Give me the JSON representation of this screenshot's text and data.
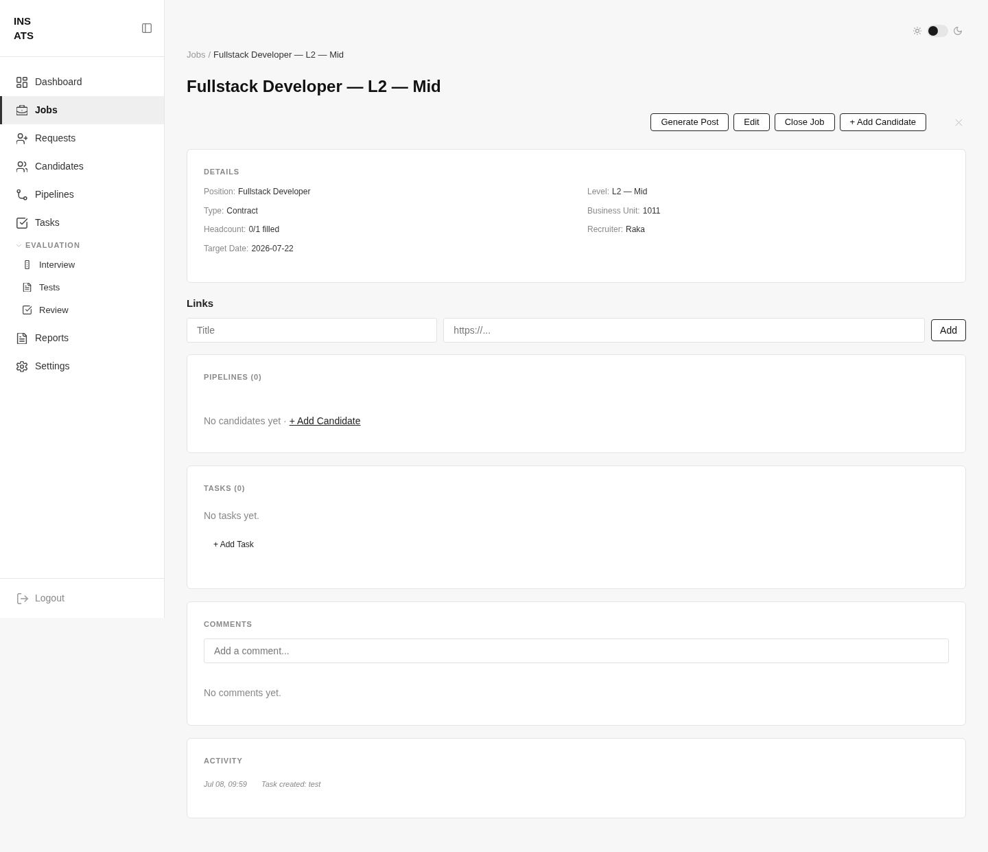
{
  "sidebar": {
    "brand": "INS ATS",
    "items": [
      {
        "kind": "link",
        "label": "Dashboard",
        "selected": false
      },
      {
        "kind": "link",
        "label": "Jobs",
        "selected": true
      },
      {
        "kind": "link",
        "label": "Requests",
        "selected": false
      },
      {
        "kind": "link",
        "label": "Candidates",
        "selected": false
      },
      {
        "kind": "link",
        "label": "Pipelines",
        "selected": false
      },
      {
        "kind": "link",
        "label": "Tasks",
        "selected": false
      },
      {
        "kind": "section",
        "label": "EVALUATION",
        "expanded": true,
        "children": [
          {
            "label": "Interview",
            "selected": false
          },
          {
            "label": "Tests",
            "selected": false
          },
          {
            "label": "Review",
            "selected": false
          }
        ]
      },
      {
        "kind": "link",
        "label": "Reports",
        "selected": false
      },
      {
        "kind": "link",
        "label": "Settings",
        "selected": false
      }
    ],
    "logout": "Logout"
  },
  "theme_toggle": {
    "on": false
  },
  "breadcrumb": {
    "items": [
      "Jobs",
      "Fullstack Developer — L2 — Mid"
    ],
    "separator": "/"
  },
  "title": "Fullstack Developer — L2 — Mid",
  "actions": [
    "Generate Post",
    "Edit",
    "Close Job",
    "+ Add Candidate"
  ],
  "details": {
    "heading": "DETAILS",
    "columns": [
      [
        {
          "label": "Position:",
          "value": "Fullstack Developer"
        },
        {
          "label": "Type:",
          "value": "Contract"
        },
        {
          "label": "Headcount:",
          "value": "0/1 filled"
        },
        {
          "label": "Target Date:",
          "value": "2026-07-22"
        }
      ],
      [
        {
          "label": "Level:",
          "value": "L2 — Mid"
        },
        {
          "label": "Business Unit:",
          "value": "1011"
        },
        {
          "label": "Recruiter:",
          "value": "Raka"
        }
      ]
    ]
  },
  "links": {
    "heading": "Links",
    "fields": [
      {
        "placeholder": "Title"
      },
      {
        "placeholder": "https://..."
      }
    ],
    "button": "Add"
  },
  "pipelines": {
    "heading": "PIPELINES (0)",
    "empty_text": "No candidates yet ·",
    "add_link": "+ Add Candidate"
  },
  "tasks": {
    "heading": "TASKS (0)",
    "empty_text": "No tasks yet.",
    "add_button": "+ Add Task"
  },
  "comments": {
    "heading": "COMMENTS",
    "field": {
      "placeholder": "Add a comment..."
    },
    "empty_text": "No comments yet."
  },
  "activity": {
    "heading": "ACTIVITY",
    "entries": [
      {
        "time": "Jul 08, 09:59",
        "text": "Task created: test"
      }
    ]
  }
}
